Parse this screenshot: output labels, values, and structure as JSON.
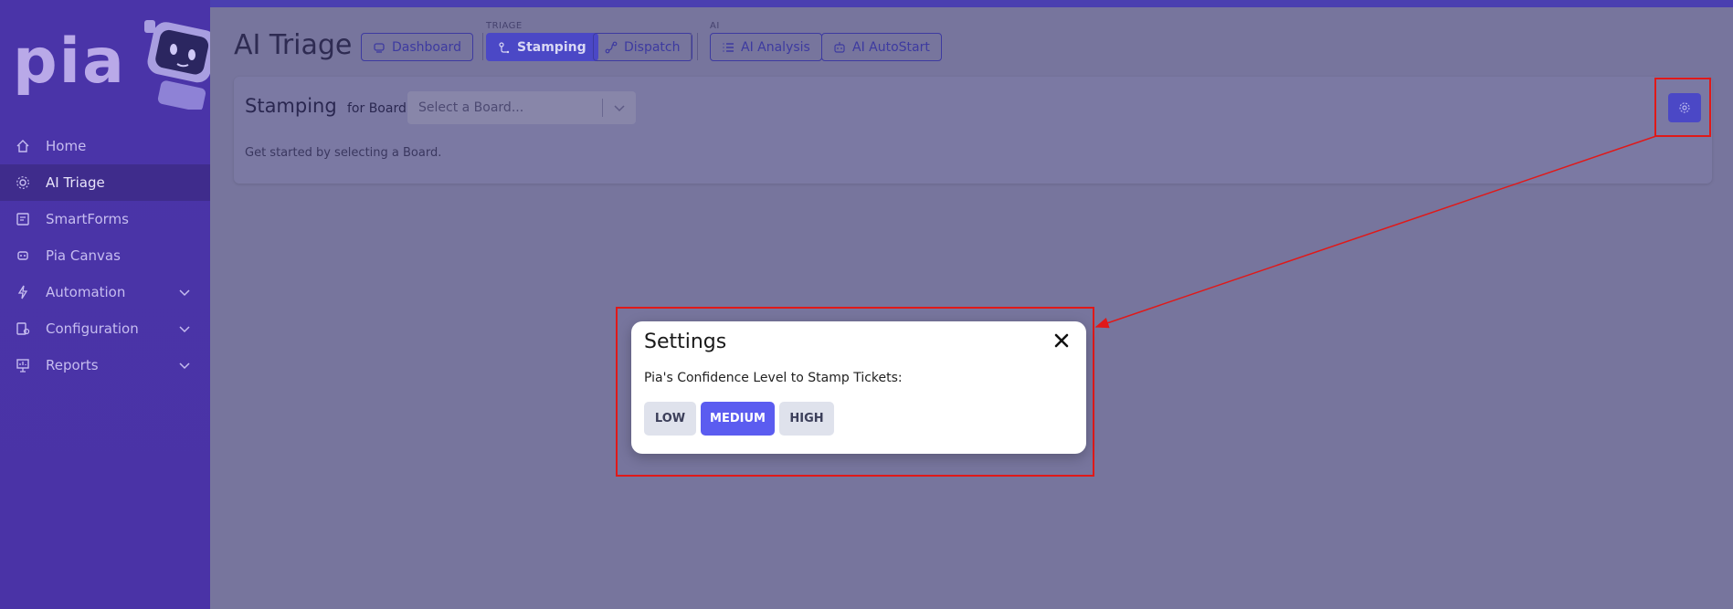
{
  "sidebar": {
    "logo": "pia",
    "items": [
      {
        "label": "Home",
        "icon": "home-icon"
      },
      {
        "label": "AI Triage",
        "icon": "triage-icon",
        "active": true
      },
      {
        "label": "SmartForms",
        "icon": "smartforms-icon"
      },
      {
        "label": "Pia Canvas",
        "icon": "canvas-icon"
      },
      {
        "label": "Automation",
        "icon": "lightning-icon",
        "expandable": true
      },
      {
        "label": "Configuration",
        "icon": "configuration-icon",
        "expandable": true
      },
      {
        "label": "Reports",
        "icon": "reports-icon",
        "expandable": true
      }
    ]
  },
  "header": {
    "title": "AI Triage",
    "dashboard_label": "Dashboard",
    "triage_group_label": "TRIAGE",
    "stamping_label": "Stamping",
    "dispatch_label": "Dispatch",
    "ai_group_label": "AI",
    "ai_analysis_label": "AI Analysis",
    "ai_autostart_label": "AI AutoStart"
  },
  "card": {
    "title": "Stamping",
    "for_board_label": "for Board",
    "board_select_placeholder": "Select a Board...",
    "hint": "Get started by selecting a Board."
  },
  "modal": {
    "title": "Settings",
    "label": "Pia's Confidence Level to Stamp Tickets:",
    "options": [
      "LOW",
      "MEDIUM",
      "HIGH"
    ],
    "selected": "MEDIUM"
  },
  "colors": {
    "accent": "#5b5cf0",
    "sidebar": "#4a34a8",
    "annotation_red": "#e01919"
  }
}
